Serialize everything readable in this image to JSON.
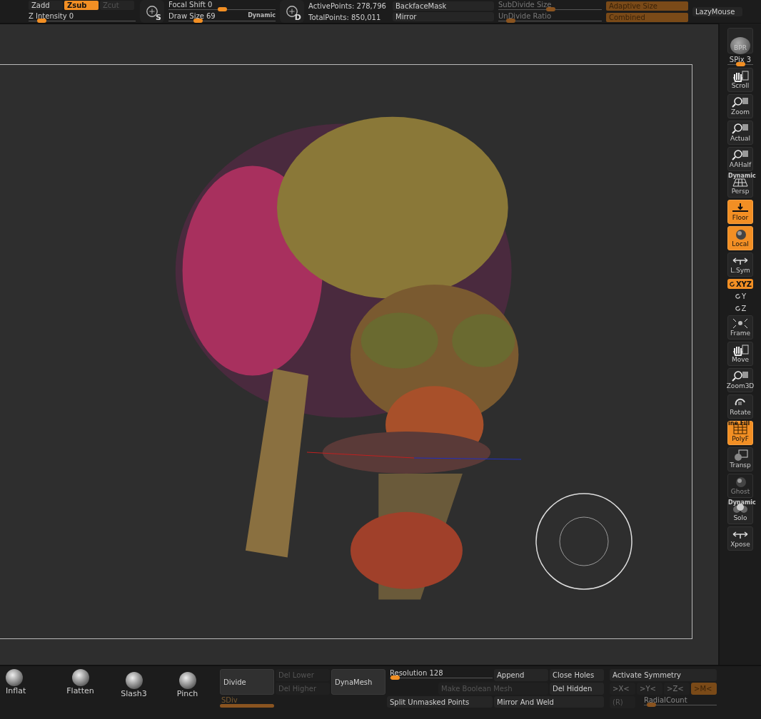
{
  "top_bar": {
    "z_modes": [
      {
        "label": "Zadd",
        "selected": false,
        "disabled": false
      },
      {
        "label": "Zsub",
        "selected": true,
        "disabled": false
      },
      {
        "label": "Zcut",
        "selected": false,
        "disabled": true
      }
    ],
    "z_intensity": {
      "label": "Z Intensity",
      "value": "0",
      "level": 0.12
    },
    "stroke_icon": "S",
    "focal_shift": {
      "label": "Focal Shift",
      "value": "0",
      "level": 0.5
    },
    "draw_size": {
      "label": "Draw Size",
      "value": "69",
      "level": 0.27
    },
    "dynamic": "Dynamic",
    "alpha_icon": "D",
    "active_points": "ActivePoints: 278,796",
    "total_points": "TotalPoints: 850,011",
    "backface_mask": "BackfaceMask",
    "mirror": "Mirror",
    "subdivide_size": {
      "label": "SubDivide Size",
      "level": 0.5,
      "disabled": true
    },
    "undivide_ratio": {
      "label": "UnDivide Ratio",
      "level": 0.12,
      "disabled": true
    },
    "adaptive_size": "Adaptive Size",
    "combined": "Combined",
    "lazy_mouse": "LazyMouse"
  },
  "right_shelf": [
    {
      "kind": "bpr",
      "label": "BPR"
    },
    {
      "kind": "slider",
      "label": "SPix",
      "value": "3",
      "level": 0.5
    },
    {
      "kind": "button",
      "label": "Scroll",
      "on": false,
      "disabled": false
    },
    {
      "kind": "button",
      "label": "Zoom",
      "on": false,
      "disabled": false
    },
    {
      "kind": "button",
      "label": "Actual",
      "on": false,
      "disabled": false
    },
    {
      "kind": "button",
      "label": "AAHalf",
      "on": false,
      "disabled": false
    },
    {
      "kind": "button",
      "label": "Persp",
      "caption": "Dynamic",
      "on": false,
      "disabled": false
    },
    {
      "kind": "button",
      "label": "Floor",
      "on": true,
      "disabled": false
    },
    {
      "kind": "button",
      "label": "Local",
      "on": true,
      "disabled": false
    },
    {
      "kind": "button",
      "label": "L.Sym",
      "on": false,
      "disabled": false
    },
    {
      "kind": "small",
      "label": "XYZ",
      "on": true
    },
    {
      "kind": "rotate",
      "label": "Y"
    },
    {
      "kind": "rotate",
      "label": "Z"
    },
    {
      "kind": "button",
      "label": "Frame",
      "on": false,
      "disabled": false
    },
    {
      "kind": "button",
      "label": "Move",
      "on": false,
      "disabled": false
    },
    {
      "kind": "button",
      "label": "Zoom3D",
      "on": false,
      "disabled": false
    },
    {
      "kind": "button",
      "label": "Rotate",
      "on": false,
      "disabled": false
    },
    {
      "kind": "button",
      "label": "PolyF",
      "caption": "ine Fill",
      "on": true,
      "disabled": false
    },
    {
      "kind": "button",
      "label": "Transp",
      "on": false,
      "disabled": false
    },
    {
      "kind": "button",
      "label": "Ghost",
      "on": false,
      "disabled": true
    },
    {
      "kind": "button",
      "label": "Solo",
      "caption": "Dynamic",
      "on": false,
      "disabled": false
    },
    {
      "kind": "button",
      "label": "Xpose",
      "on": false,
      "disabled": false
    }
  ],
  "brushes": [
    {
      "label": "Inflat"
    },
    {
      "label": "Flatten"
    },
    {
      "label": "Slash3"
    },
    {
      "label": "Pinch"
    }
  ],
  "geometry": {
    "divide": {
      "label": "Divide",
      "disabled": false
    },
    "del_lower": {
      "label": "Del Lower",
      "disabled": true
    },
    "del_higher": {
      "label": "Del Higher",
      "disabled": true
    },
    "sdiv": {
      "label": "SDiv",
      "level": 1
    },
    "dynamesh": {
      "label": "DynaMesh",
      "disabled": false
    },
    "resolution": {
      "label": "Resolution",
      "value": "128",
      "level": 0.05
    },
    "append": {
      "label": "Append",
      "disabled": false
    },
    "make_boolean": {
      "label": "Make Boolean Mesh",
      "disabled": true
    },
    "close_holes": {
      "label": "Close Holes",
      "disabled": false
    },
    "del_hidden": {
      "label": "Del Hidden",
      "disabled": false
    },
    "split": {
      "label": "Split Unmasked Points",
      "disabled": false
    },
    "mirror_weld": {
      "label": "Mirror And Weld",
      "disabled": false
    }
  },
  "symmetry": {
    "activate": "Activate Symmetry",
    "axes": [
      {
        "label": ">X<",
        "selected": false
      },
      {
        "label": ">Y<",
        "selected": false
      },
      {
        "label": ">Z<",
        "selected": false
      },
      {
        "label": ">M<",
        "selected": true
      }
    ],
    "radial": "(R)",
    "radial_count": {
      "label": "RadialCount",
      "level": 0.1
    }
  }
}
